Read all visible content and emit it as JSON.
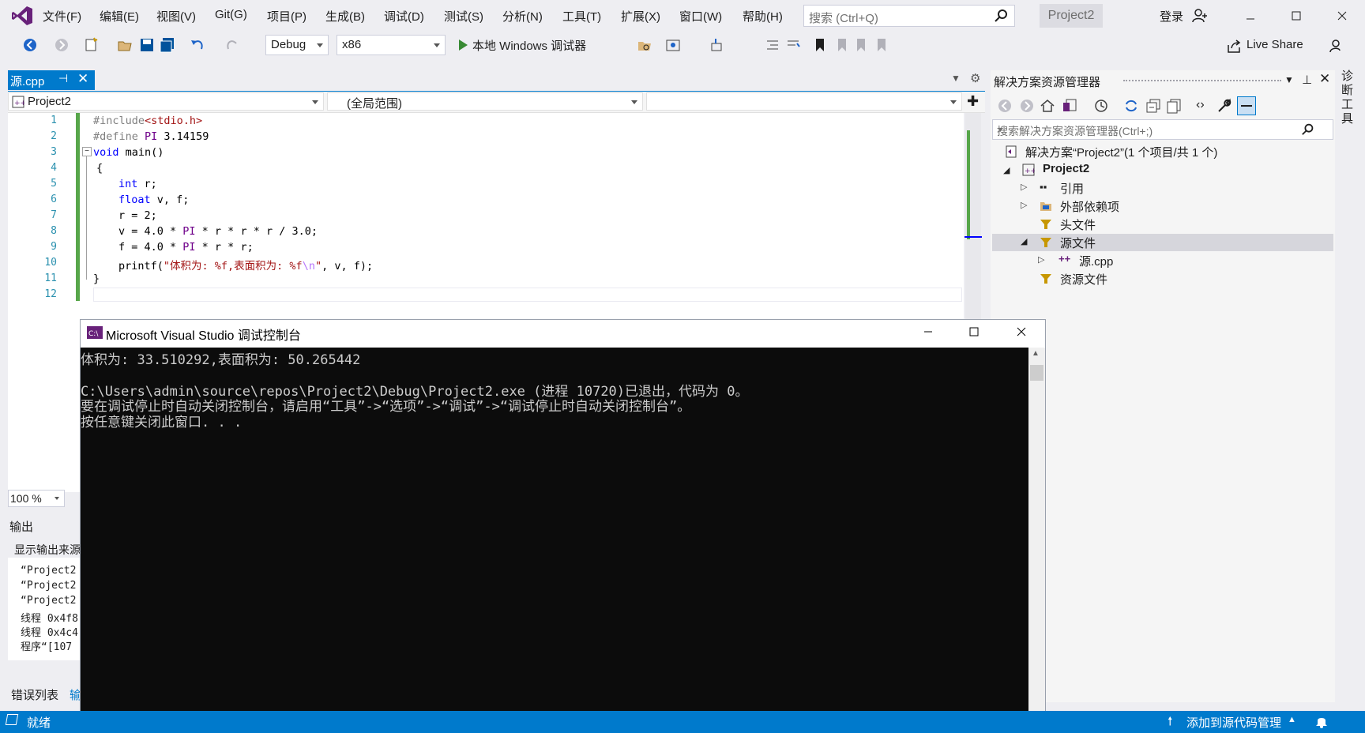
{
  "menu": [
    "文件(F)",
    "编辑(E)",
    "视图(V)",
    "Git(G)",
    "项目(P)",
    "生成(B)",
    "调试(D)",
    "测试(S)",
    "分析(N)",
    "工具(T)",
    "扩展(X)",
    "窗口(W)",
    "帮助(H)"
  ],
  "search": {
    "placeholder": "搜索 (Ctrl+Q)"
  },
  "project_badge": "Project2",
  "login": "登录",
  "toolbar": {
    "config": "Debug",
    "platform": "x86",
    "run_label": "本地 Windows 调试器",
    "live_share": "Live Share"
  },
  "editor": {
    "tab_name": "源.cpp",
    "nav_project": "Project2",
    "nav_scope": "(全局范围)",
    "line_numbers": [
      "1",
      "2",
      "3",
      "4",
      "5",
      "6",
      "7",
      "8",
      "9",
      "10",
      "11",
      "12"
    ],
    "zoom": "100 %"
  },
  "code": {
    "l1_a": "#include",
    "l1_b": "<stdio.h>",
    "l2_a": "#define ",
    "l2_b": "PI",
    "l2_c": " 3.14159",
    "l3_a": "void",
    "l3_b": " main()",
    "l4": "{",
    "l5_a": "int",
    "l5_b": " r;",
    "l6_a": "float",
    "l6_b": " v, f;",
    "l7": "r = 2;",
    "l8_a": "v = 4.0 * ",
    "l8_b": "PI",
    "l8_c": " * r * r * r / 3.0;",
    "l9_a": "f = 4.0 * ",
    "l9_b": "PI",
    "l9_c": " * r * r;",
    "l10_a": "printf(",
    "l10_b": "\"体积为: %f,表面积为: %f",
    "l10_c": "\\n",
    "l10_d": "\"",
    "l10_e": ", v, f);",
    "l11": "}"
  },
  "output": {
    "title": "输出",
    "source_label": "显示输出来源",
    "lines": [
      "“Project2",
      "“Project2",
      "“Project2",
      "线程 0x4f8",
      "线程 0x4c4",
      "程序“[107"
    ],
    "tabs": [
      "错误列表",
      "输"
    ]
  },
  "solution_explorer": {
    "title": "解决方案资源管理器",
    "search_placeholder": "搜索解决方案资源管理器(Ctrl+;)",
    "solution": "解决方案“Project2”(1 个项目/共 1 个)",
    "project": "Project2",
    "refs": "引用",
    "external": "外部依赖项",
    "headers": "头文件",
    "sources": "源文件",
    "source_file": "源.cpp",
    "resources": "资源文件"
  },
  "side_strip": "诊断工具",
  "console": {
    "title": "Microsoft Visual Studio 调试控制台",
    "lines": [
      "体积为: 33.510292,表面积为: 50.265442",
      "",
      "C:\\Users\\admin\\source\\repos\\Project2\\Debug\\Project2.exe (进程 10720)已退出，代码为 0。",
      "要在调试停止时自动关闭控制台，请启用“工具”->“选项”->“调试”->“调试停止时自动关闭控制台”。",
      "按任意键关闭此窗口. . ."
    ]
  },
  "status": {
    "ready": "就绪",
    "add_source_control": "添加到源代码管理"
  }
}
